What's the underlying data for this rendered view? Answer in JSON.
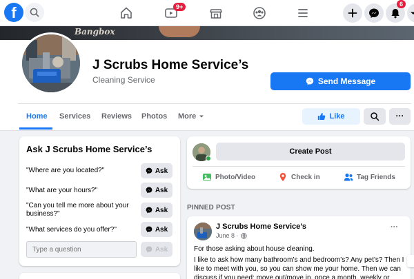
{
  "topnav": {
    "logo_letter": "f",
    "video_badge": "9+",
    "notifications_badge": "6",
    "icons": [
      "search-icon",
      "home-icon",
      "watch-icon",
      "marketplace-icon",
      "groups-icon",
      "menu-icon",
      "plus-icon",
      "messenger-icon",
      "bell-icon",
      "caret-icon"
    ]
  },
  "cover": {
    "text": "Bangbox"
  },
  "header": {
    "page_name": "J Scrubs Home Service’s",
    "category": "Cleaning Service",
    "send_message_label": "Send Message"
  },
  "tabs": [
    {
      "label": "Home",
      "active": true
    },
    {
      "label": "Services",
      "active": false
    },
    {
      "label": "Reviews",
      "active": false
    },
    {
      "label": "Photos",
      "active": false
    },
    {
      "label": "More",
      "active": false
    }
  ],
  "actions": {
    "like_label": "Like",
    "more_label": "···"
  },
  "ask": {
    "title": "Ask J Scrubs Home Service’s",
    "questions": [
      "\"Where are you located?\"",
      "\"What are your hours?\"",
      "\"Can you tell me more about your business?\"",
      "\"What services do you offer?\""
    ],
    "ask_label": "Ask",
    "input_placeholder": "Type a question"
  },
  "create_post": {
    "button_label": "Create Post",
    "actions": [
      "Photo/Video",
      "Check in",
      "Tag Friends"
    ]
  },
  "pinned": {
    "section_label": "PINNED POST",
    "author": "J Scrubs Home Service’s",
    "date": "June 8 ·",
    "menu": "···",
    "text_line1": "For those asking about house cleaning.",
    "text_body": "I like to ask how many bathroom’s and bedroom’s? Any pet’s? Then I like to meet with you, so you can show me your home. Then we can discuss if you need: move out/move in, once a month, weekly or"
  },
  "colors": {
    "brand_blue": "#1877f2",
    "light_blue": "#e7f3ff",
    "badge_red": "#e41e3f",
    "online_green": "#31a24c"
  }
}
